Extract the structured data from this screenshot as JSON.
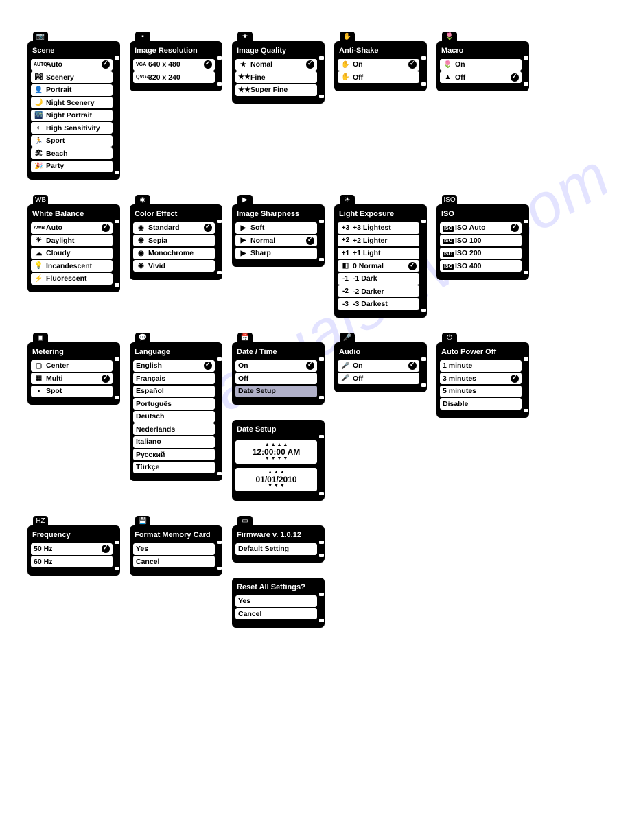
{
  "watermark": "manualshive.com",
  "menus": [
    {
      "id": "scene",
      "title": "Scene",
      "tabIcon": "📷",
      "items": [
        {
          "icon": "AUTO",
          "label": "Auto",
          "selected": true
        },
        {
          "icon": "🏞",
          "label": "Scenery"
        },
        {
          "icon": "👤",
          "label": "Portrait"
        },
        {
          "icon": "🌙",
          "label": "Night Scenery"
        },
        {
          "icon": "🌃",
          "label": "Night Portrait"
        },
        {
          "icon": "◐",
          "label": "High Sensitivity"
        },
        {
          "icon": "🏃",
          "label": "Sport"
        },
        {
          "icon": "🏖",
          "label": "Beach"
        },
        {
          "icon": "🎉",
          "label": "Party"
        }
      ]
    },
    {
      "id": "resolution",
      "title": "Image Resolution",
      "tabIcon": "▪",
      "items": [
        {
          "icon": "VGA",
          "label": "640 x 480",
          "selected": true
        },
        {
          "icon": "QVGA",
          "label": "320 x 240"
        }
      ]
    },
    {
      "id": "quality",
      "title": "Image Quality",
      "tabIcon": "★",
      "items": [
        {
          "icon": "★",
          "label": "Nomal",
          "selected": true
        },
        {
          "icon": "★★",
          "label": "Fine"
        },
        {
          "icon": "★★",
          "label": "Super Fine"
        }
      ]
    },
    {
      "id": "antishake",
      "title": "Anti-Shake",
      "tabIcon": "✋",
      "items": [
        {
          "icon": "✋",
          "label": "On",
          "selected": true
        },
        {
          "icon": "✋",
          "label": "Off"
        }
      ]
    },
    {
      "id": "macro",
      "title": "Macro",
      "tabIcon": "🌷",
      "items": [
        {
          "icon": "🌷",
          "label": "On"
        },
        {
          "icon": "▲",
          "label": "Off",
          "selected": true
        }
      ]
    },
    {
      "id": "wb",
      "title": "White Balance",
      "tabIcon": "WB",
      "items": [
        {
          "icon": "AWB",
          "label": "Auto",
          "selected": true
        },
        {
          "icon": "☀",
          "label": "Daylight"
        },
        {
          "icon": "☁",
          "label": "Cloudy"
        },
        {
          "icon": "💡",
          "label": "Incandescent"
        },
        {
          "icon": "⚡",
          "label": "Fluorescent"
        }
      ]
    },
    {
      "id": "effect",
      "title": "Color Effect",
      "tabIcon": "◉",
      "items": [
        {
          "icon": "◉",
          "label": "Standard",
          "selected": true
        },
        {
          "icon": "◉",
          "label": "Sepia"
        },
        {
          "icon": "◉",
          "label": "Monochrome"
        },
        {
          "icon": "◉",
          "label": "Vivid"
        }
      ]
    },
    {
      "id": "sharp",
      "title": "Image Sharpness",
      "tabIcon": "▶",
      "items": [
        {
          "icon": "▶",
          "label": "Soft"
        },
        {
          "icon": "▶",
          "label": "Normal",
          "selected": true
        },
        {
          "icon": "▶",
          "label": "Sharp"
        }
      ]
    },
    {
      "id": "expo",
      "title": "Light Exposure",
      "tabIcon": "☀",
      "items": [
        {
          "icon": "+3",
          "label": "+3 Lightest"
        },
        {
          "icon": "+2",
          "label": "+2 Lighter"
        },
        {
          "icon": "+1",
          "label": "+1 Light"
        },
        {
          "icon": "◧",
          "label": "0 Normal",
          "selected": true
        },
        {
          "icon": "-1",
          "label": "-1 Dark"
        },
        {
          "icon": "-2",
          "label": "-2 Darker"
        },
        {
          "icon": "-3",
          "label": "-3 Darkest"
        }
      ]
    },
    {
      "id": "iso",
      "title": "ISO",
      "tabIcon": "ISO",
      "items": [
        {
          "icon": "ISO",
          "label": "ISO Auto",
          "selected": true
        },
        {
          "icon": "ISO",
          "label": "ISO 100"
        },
        {
          "icon": "ISO",
          "label": "ISO 200"
        },
        {
          "icon": "ISO",
          "label": "ISO 400"
        }
      ]
    },
    {
      "id": "meter",
      "title": "Metering",
      "tabIcon": "▣",
      "items": [
        {
          "icon": "▢",
          "label": "Center"
        },
        {
          "icon": "▦",
          "label": "Multi",
          "selected": true
        },
        {
          "icon": "▪",
          "label": "Spot"
        }
      ]
    },
    {
      "id": "lang",
      "title": "Language",
      "tabIcon": "💬",
      "items": [
        {
          "label": "English",
          "selected": true
        },
        {
          "label": "Français"
        },
        {
          "label": "Español"
        },
        {
          "label": "Português"
        },
        {
          "label": "Deutsch"
        },
        {
          "label": "Nederlands"
        },
        {
          "label": "Italiano"
        },
        {
          "label": "Русский"
        },
        {
          "label": "Türkçe"
        }
      ]
    },
    {
      "id": "datetime",
      "title": "Date / Time",
      "tabIcon": "📅",
      "items": [
        {
          "label": "On",
          "selected": true
        },
        {
          "label": "Off"
        },
        {
          "label": "Date Setup",
          "hl": true
        }
      ]
    },
    {
      "id": "datesetup",
      "title": "Date Setup",
      "tabIcon": "",
      "setupTime": "12:00:00 AM",
      "setupDate": "01/01/2010"
    },
    {
      "id": "audio",
      "title": "Audio",
      "tabIcon": "🎤",
      "items": [
        {
          "icon": "🎤",
          "label": "On",
          "selected": true
        },
        {
          "icon": "🎤",
          "label": "Off"
        }
      ]
    },
    {
      "id": "apo",
      "title": "Auto Power Off",
      "tabIcon": "⏻",
      "items": [
        {
          "label": "1 minute"
        },
        {
          "label": "3 minutes",
          "selected": true
        },
        {
          "label": "5 minutes"
        },
        {
          "label": "Disable"
        }
      ]
    },
    {
      "id": "freq",
      "title": "Frequency",
      "tabIcon": "HZ",
      "items": [
        {
          "label": "50 Hz",
          "selected": true
        },
        {
          "label": "60 Hz"
        }
      ]
    },
    {
      "id": "format",
      "title": "Format Memory Card",
      "tabIcon": "💾",
      "items": [
        {
          "label": "Yes"
        },
        {
          "label": "Cancel"
        }
      ]
    },
    {
      "id": "fw",
      "title": "Firmware v. 1.0.12",
      "tabIcon": "▭",
      "items": [
        {
          "label": "Default Setting",
          "center": true
        }
      ]
    },
    {
      "id": "reset",
      "title": "Reset All Settings?",
      "tabIcon": "",
      "items": [
        {
          "label": "Yes"
        },
        {
          "label": "Cancel"
        }
      ]
    }
  ],
  "layout_rows": [
    [
      "scene",
      "resolution",
      "quality",
      "antishake",
      "macro"
    ],
    [
      "wb",
      "effect",
      "sharp",
      "expo",
      "iso"
    ],
    [
      "meter",
      "lang",
      [
        "datetime",
        "datesetup"
      ],
      "audio",
      "apo"
    ],
    [
      "freq",
      "format",
      [
        "fw",
        "reset"
      ]
    ]
  ]
}
